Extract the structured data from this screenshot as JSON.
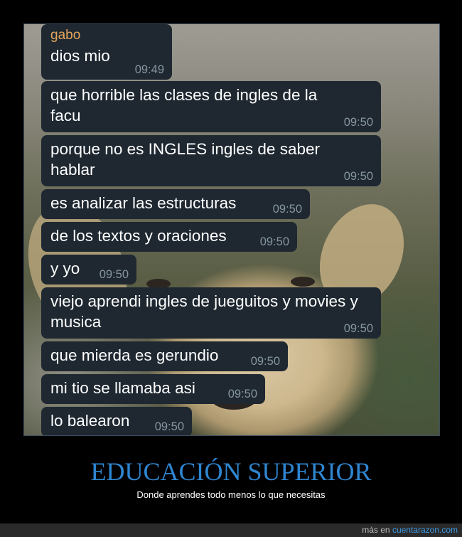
{
  "chat": {
    "sender": "gabo",
    "messages": [
      {
        "text": "dios mio",
        "time": "09:49"
      },
      {
        "text": "que horrible las clases de ingles de la facu",
        "time": "09:50"
      },
      {
        "text": "porque no es INGLES ingles de saber hablar",
        "time": "09:50"
      },
      {
        "text": "es analizar las estructuras",
        "time": "09:50"
      },
      {
        "text": "de los textos y oraciones",
        "time": "09:50"
      },
      {
        "text": "y yo",
        "time": "09:50"
      },
      {
        "text": "viejo aprendi ingles de jueguitos y movies y musica",
        "time": "09:50"
      },
      {
        "text": "que mierda es gerundio",
        "time": "09:50"
      },
      {
        "text": "mi tio se llamaba asi",
        "time": "09:50"
      },
      {
        "text": "lo balearon",
        "time": "09:50"
      }
    ]
  },
  "caption": {
    "title": "EDUCACIÓN SUPERIOR",
    "subtitle": "Donde aprendes todo menos lo que necesitas"
  },
  "footer": {
    "prefix": "más en",
    "site": "cuentarazon.com"
  },
  "colors": {
    "bubble": "#1f2831",
    "sender": "#e3a55b",
    "timestamp": "#8696a0",
    "title": "#2f86d0",
    "link": "#3f9be6"
  }
}
